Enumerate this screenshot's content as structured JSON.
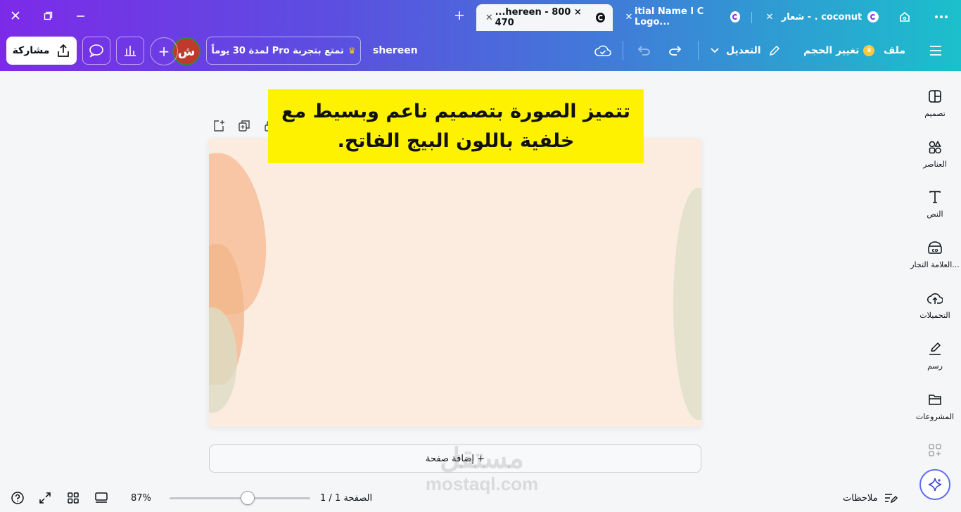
{
  "browser": {
    "tabs": [
      {
        "title": "coconut . - شعار"
      },
      {
        "title": "itial Name I C Logo..."
      },
      {
        "title": "...hereen - 800 × 470",
        "active": true
      }
    ],
    "new_tab_symbol": "+"
  },
  "toolbar": {
    "menu_label": "ملف",
    "resize_label": "تغيير الحجم",
    "edit_label": "التعديل",
    "design_name": "shereen",
    "pro_trial_label": "تمتع بتجربة Pro لمدة 30 يوماً",
    "avatar_letter": "ش",
    "add_symbol": "+",
    "share_label": "مشاركة"
  },
  "sidebar": {
    "items": [
      {
        "label": "تصميم",
        "icon": "layout-icon"
      },
      {
        "label": "العناصر",
        "icon": "shapes-icon"
      },
      {
        "label": "النص",
        "icon": "text-icon"
      },
      {
        "label": "العلامة التجار...",
        "icon": "brand-icon"
      },
      {
        "label": "التحميلات",
        "icon": "upload-cloud-icon"
      },
      {
        "label": "رسم",
        "icon": "pen-icon"
      },
      {
        "label": "المشروعات",
        "icon": "folder-icon"
      }
    ]
  },
  "canvas": {
    "caption": "تتميز الصورة بتصميم ناعم وبسيط مع خلفية باللون البيج الفاتح.",
    "add_page_label": "+ إضافة صفحة"
  },
  "watermark": {
    "line1": "مستقل",
    "line2": "mostaql.com"
  },
  "footer": {
    "notes_label": "ملاحظات",
    "page_indicator": "الصفحة 1 / 1",
    "zoom_percent": "87%",
    "zoom_value": 87
  },
  "colors": {
    "gradient_start": "#7d2ae8",
    "gradient_end": "#1bc0cc",
    "canvas_bg": "#fcece0",
    "callout_bg": "#fff200"
  }
}
